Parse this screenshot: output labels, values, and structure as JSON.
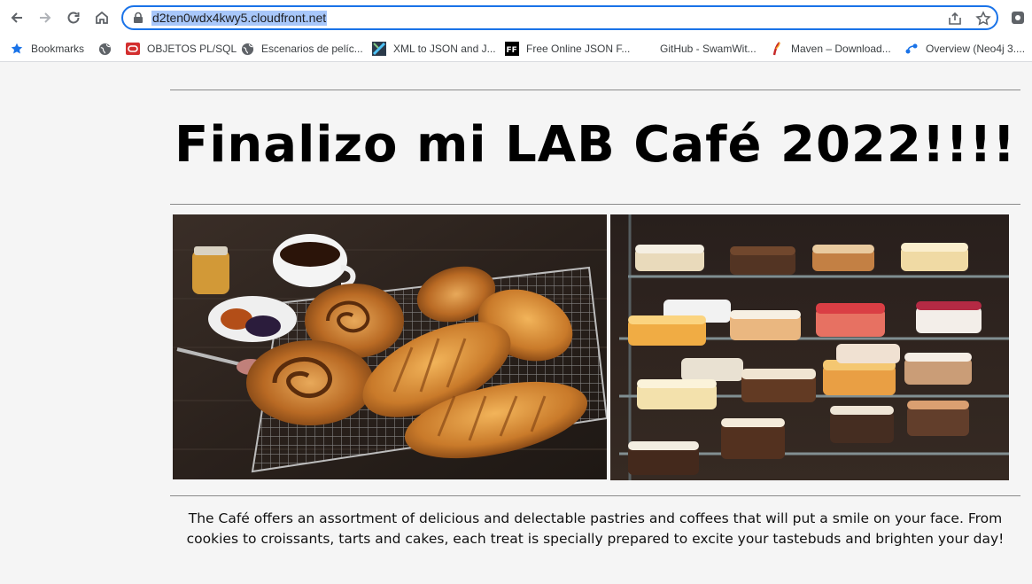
{
  "browser": {
    "url": "d2ten0wdx4kwy5.cloudfront.net",
    "bookmarks": [
      {
        "label": "Bookmarks",
        "icon": "star-icon"
      },
      {
        "label": "",
        "icon": "globe-icon"
      },
      {
        "label": "OBJETOS PL/SQL",
        "icon": "oracle-icon"
      },
      {
        "label": "Escenarios de pelíc...",
        "icon": "globe-icon"
      },
      {
        "label": "XML to JSON and J...",
        "icon": "xml-json-icon"
      },
      {
        "label": "Free Online JSON F...",
        "icon": "ff-icon"
      },
      {
        "label": "GitHub - SwamWit...",
        "icon": "github-icon"
      },
      {
        "label": "Maven – Download...",
        "icon": "maven-icon"
      },
      {
        "label": "Overview (Neo4j 3....",
        "icon": "neo4j-icon"
      }
    ]
  },
  "page": {
    "title": "Finalizo mi LAB Café 2022!!!!",
    "images": [
      {
        "name": "pastries-coffee-photo"
      },
      {
        "name": "cake-display-photo"
      }
    ],
    "description": "The Café offers an assortment of delicious and delectable pastries and coffees that will put a smile on your face. From cookies to croissants, tarts and cakes, each treat is specially prepared to excite your tastebuds and brighten your day!"
  }
}
